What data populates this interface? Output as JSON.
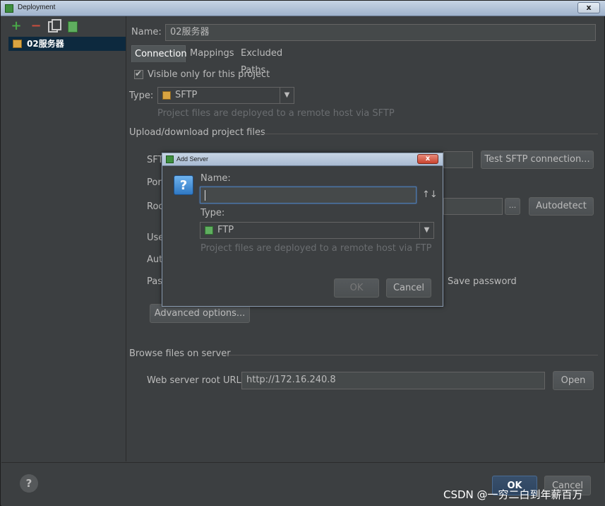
{
  "window": {
    "title": "Deployment",
    "close_label": "x"
  },
  "toolbar": {
    "add_glyph": "+",
    "remove_glyph": "−"
  },
  "tree": {
    "selected_item": "02服务器"
  },
  "server": {
    "name_label": "Name:",
    "name_value": "02服务器"
  },
  "tabs": [
    {
      "label": "Connection",
      "active": true
    },
    {
      "label": "Mappings",
      "active": false
    },
    {
      "label": "Excluded Paths",
      "active": false
    }
  ],
  "connection": {
    "visible_only_label": "Visible only for this project",
    "visible_only_checked": true,
    "type_label": "Type:",
    "type_value": "SFTP",
    "type_hint": "Project files are deployed to a remote host via SFTP",
    "upload_section": "Upload/download project files",
    "sftp_label_partial": "SFT",
    "port_label_partial": "Por",
    "root_label_partial": "Roo",
    "user_label_partial": "Use",
    "auth_label_partial": "Aut",
    "pass_label_partial": "Pas",
    "test_button": "Test SFTP connection...",
    "browse_button": "...",
    "autodetect_button": "Autodetect",
    "save_password_label": "Save password",
    "advanced_button": "Advanced options..."
  },
  "browse": {
    "section": "Browse files on server",
    "web_root_label": "Web server root URL:",
    "web_root_value": "http://172.16.240.8",
    "open_button": "Open"
  },
  "footer": {
    "help_glyph": "?",
    "ok_button": "OK",
    "cancel_button": "Cancel"
  },
  "watermark": "CSDN @一穷二白到年薪百万",
  "add_server_dialog": {
    "title": "Add Server",
    "close_label": "x",
    "help_glyph": "?",
    "name_label": "Name:",
    "name_value": "",
    "sort_glyph": "↑↓",
    "type_label": "Type:",
    "type_value": "FTP",
    "type_hint": "Project files are deployed to a remote host via FTP",
    "ok_button": "OK",
    "cancel_button": "Cancel"
  }
}
